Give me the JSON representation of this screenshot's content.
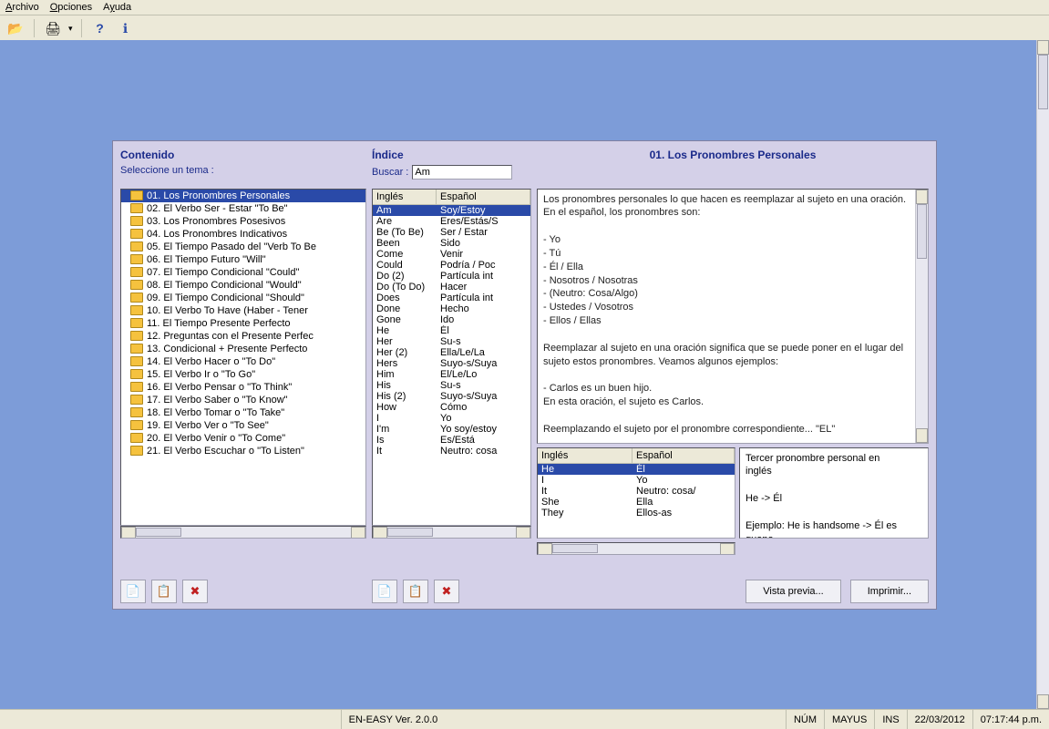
{
  "menu": {
    "archivo": "Archivo",
    "opciones": "Opciones",
    "ayuda": "Ayuda"
  },
  "headers": {
    "contenido": "Contenido",
    "seleccione": "Seleccione un tema :",
    "indice": "Índice",
    "buscar": "Buscar :",
    "search_value": "Am",
    "title": "01. Los Pronombres Personales"
  },
  "topics": [
    "01. Los Pronombres Personales",
    "02. El Verbo Ser - Estar \"To Be\"",
    "03. Los Pronombres Posesivos",
    "04. Los Pronombres Indicativos",
    "05. El Tiempo Pasado del \"Verb To Be",
    "06. El Tiempo Futuro \"Will\"",
    "07. El Tiempo Condicional \"Could\"",
    "08. El Tiempo Condicional \"Would\"",
    "09. El Tiempo Condicional \"Should\"",
    "10. El Verbo To Have (Haber - Tener",
    "11. El Tiempo Presente Perfecto",
    "12. Preguntas con el Presente Perfec",
    "13. Condicional + Presente Perfecto",
    "14. El Verbo Hacer o \"To Do\"",
    "15. El Verbo Ir o \"To Go\"",
    "16. El Verbo Pensar o \"To Think\"",
    "17. El Verbo Saber o \"To Know\"",
    "18. El Verbo Tomar o \"To Take\"",
    "19. El Verbo Ver o \"To See\"",
    "20. El Verbo Venir o \"To Come\"",
    "21. El Verbo Escuchar o \"To Listen\""
  ],
  "index_cols": {
    "en": "Inglés",
    "es": "Español"
  },
  "index_rows": [
    {
      "en": "Am",
      "es": "Soy/Estoy"
    },
    {
      "en": "Are",
      "es": "Eres/Estás/S"
    },
    {
      "en": "Be (To Be)",
      "es": "Ser / Estar"
    },
    {
      "en": "Been",
      "es": "Sido"
    },
    {
      "en": "Come",
      "es": "Venir"
    },
    {
      "en": "Could",
      "es": "Podría / Poc"
    },
    {
      "en": "Do (2)",
      "es": "Partícula int"
    },
    {
      "en": "Do (To Do)",
      "es": "Hacer"
    },
    {
      "en": "Does",
      "es": "Partícula int"
    },
    {
      "en": "Done",
      "es": "Hecho"
    },
    {
      "en": "Gone",
      "es": "Ido"
    },
    {
      "en": "He",
      "es": "Él"
    },
    {
      "en": "Her",
      "es": "Su-s"
    },
    {
      "en": "Her (2)",
      "es": "Ella/Le/La"
    },
    {
      "en": "Hers",
      "es": "Suyo-s/Suya"
    },
    {
      "en": "Him",
      "es": "El/Le/Lo"
    },
    {
      "en": "His",
      "es": "Su-s"
    },
    {
      "en": "His (2)",
      "es": "Suyo-s/Suya"
    },
    {
      "en": "How",
      "es": "Cómo"
    },
    {
      "en": "I",
      "es": "Yo"
    },
    {
      "en": "I'm",
      "es": "Yo soy/estoy"
    },
    {
      "en": "Is",
      "es": "Es/Está"
    },
    {
      "en": "It",
      "es": "Neutro: cosa"
    }
  ],
  "description_lines": [
    "Los pronombres personales lo que hacen es reemplazar al sujeto en una oración. En el español, los pronombres son:",
    "",
    "- Yo",
    "- Tú",
    "- Él / Ella",
    "- Nosotros / Nosotras",
    "- (Neutro: Cosa/Algo)",
    "- Ustedes / Vosotros",
    "- Ellos / Ellas",
    "",
    "Reemplazar al sujeto en una oración significa que se puede poner en el lugar del sujeto estos pronombres. Veamos algunos ejemplos:",
    "",
    "- Carlos es un buen hijo.",
    "En esta oración, el sujeto es Carlos.",
    "",
    "Reemplazando el sujeto por el pronombre correspondiente... \"EL\""
  ],
  "small_grid_cols": {
    "en": "Inglés",
    "es": "Español"
  },
  "small_grid_rows": [
    {
      "en": "He",
      "es": "Él"
    },
    {
      "en": "I",
      "es": "Yo"
    },
    {
      "en": "It",
      "es": "Neutro: cosa/"
    },
    {
      "en": "She",
      "es": "Ella"
    },
    {
      "en": "They",
      "es": "Ellos-as"
    }
  ],
  "detail_lines": [
    "Tercer pronombre personal en inglés",
    "",
    "He -> Él",
    "",
    "Ejemplo:   He is handsome -> Él es guapo"
  ],
  "buttons": {
    "vista_previa": "Vista previa...",
    "imprimir": "Imprimir..."
  },
  "status": {
    "app": "EN-EASY Ver. 2.0.0",
    "num": "NÚM",
    "mayus": "MAYUS",
    "ins": "INS",
    "date": "22/03/2012",
    "time": "07:17:44 p.m."
  }
}
